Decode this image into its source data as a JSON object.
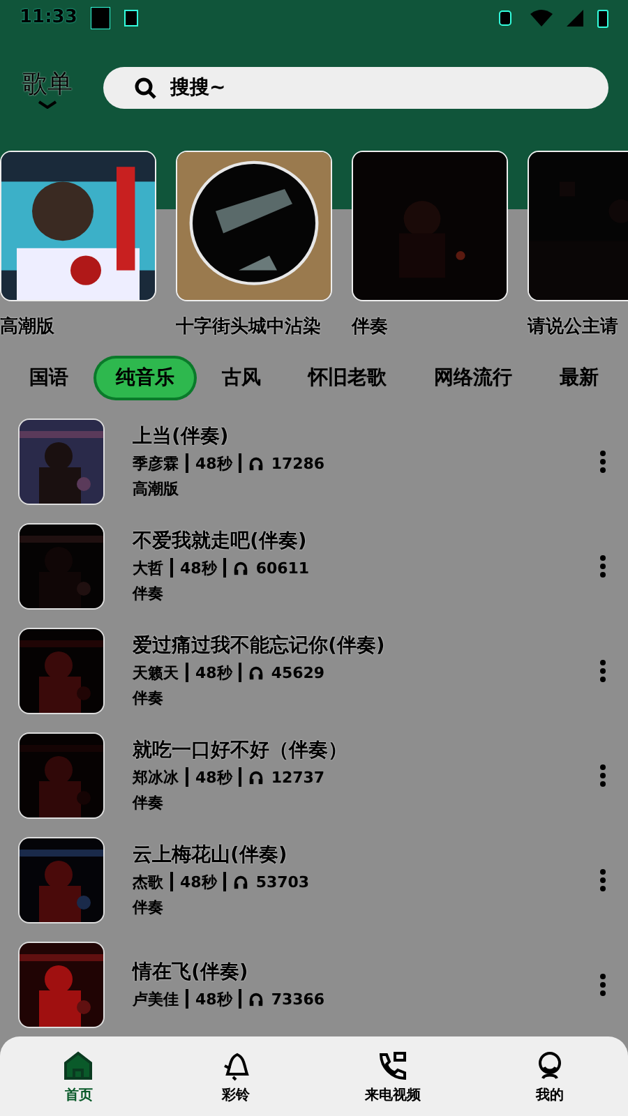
{
  "status_bar": {
    "time": "11:33"
  },
  "header": {
    "title": "歌单",
    "search": {
      "placeholder": "搜搜~"
    }
  },
  "cards": [
    {
      "title": "高潮版"
    },
    {
      "title": "十字街头城中沾染"
    },
    {
      "title": "伴奏"
    },
    {
      "title": "请说公主请"
    }
  ],
  "categories": [
    {
      "label": "国语",
      "selected": false
    },
    {
      "label": "纯音乐",
      "selected": true
    },
    {
      "label": "古风",
      "selected": false
    },
    {
      "label": "怀旧老歌",
      "selected": false
    },
    {
      "label": "网络流行",
      "selected": false
    },
    {
      "label": "最新",
      "selected": false
    }
  ],
  "songs": [
    {
      "title": "上当(伴奏)",
      "artist": "季彦霖",
      "duration": "48秒",
      "plays": "17286",
      "tag": "高潮版"
    },
    {
      "title": "不爱我就走吧(伴奏)",
      "artist": "大哲",
      "duration": "48秒",
      "plays": "60611",
      "tag": "伴奏"
    },
    {
      "title": "爱过痛过我不能忘记你(伴奏)",
      "artist": "天籁天",
      "duration": "48秒",
      "plays": "45629",
      "tag": "伴奏"
    },
    {
      "title": "就吃一口好不好（伴奏）",
      "artist": "郑冰冰",
      "duration": "48秒",
      "plays": "12737",
      "tag": "伴奏"
    },
    {
      "title": "云上梅花山(伴奏)",
      "artist": "杰歌",
      "duration": "48秒",
      "plays": "53703",
      "tag": "伴奏"
    },
    {
      "title": "情在飞(伴奏)",
      "artist": "卢美佳",
      "duration": "48秒",
      "plays": "73366"
    }
  ],
  "bottom_nav": [
    {
      "label": "首页",
      "selected": true
    },
    {
      "label": "彩铃",
      "selected": false
    },
    {
      "label": "来电视频",
      "selected": false
    },
    {
      "label": "我的",
      "selected": false
    }
  ]
}
